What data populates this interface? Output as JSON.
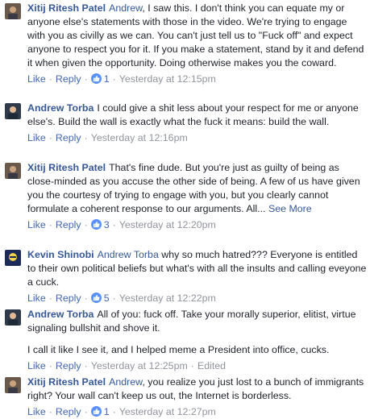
{
  "comments": [
    {
      "author": "Xitij Ritesh Patel",
      "mention": "Andrew",
      "text": ", I saw this. I don't think you can equate my or anyone else's statements with those in the video. We're trying to engage with you as civilly as we can. You can't just tell us to \"Fuck off\" and expect anyone to respect you for it. If you make a statement, stand by it and defend it when given the opportunity. Doing otherwise makes you the coward.",
      "like": "Like",
      "reply": "Reply",
      "likes": "1",
      "time": "Yesterday at 12:15pm"
    },
    {
      "author": "Andrew Torba",
      "text": "I could give a shit less about your respect for me or anyone else's. Build the wall is exactly what the fuck it means: build the wall.",
      "like": "Like",
      "reply": "Reply",
      "time": "Yesterday at 12:16pm"
    },
    {
      "author": "Xitij Ritesh Patel",
      "text": "That's fine dude. But you're just as guilty of being as close-minded as you accuse the other side of being. A few of us have given you the courtesy of trying to engage with you, but you clearly cannot formulate a coherent response to our arguments.",
      "trail": "All...",
      "see_more": "See More",
      "like": "Like",
      "reply": "Reply",
      "likes": "3",
      "time": "Yesterday at 12:20pm"
    },
    {
      "author": "Kevin Shinobi",
      "mention": "Andrew Torba",
      "text": " why so much hatred??? Everyone is entitled to their own political beliefs but what's with all the insults and calling eveyone a cuck.",
      "like": "Like",
      "reply": "Reply",
      "likes": "5",
      "time": "Yesterday at 12:22pm"
    },
    {
      "author": "Andrew Torba",
      "text": "All of you: fuck off. Take your morally superior, elitist, virtue signaling bullshit and shove it.",
      "text2": "I call it like I see it, and I helped meme a President into office, cucks.",
      "like": "Like",
      "reply": "Reply",
      "time": "Yesterday at 12:25pm",
      "edited": "Edited"
    },
    {
      "author": "Xitij Ritesh Patel",
      "mention": "Andrew",
      "text": ", you realize you just lost to a bunch of immigrants right? Your wall can't keep us out, the Internet is borderless.",
      "like": "Like",
      "reply": "Reply",
      "likes": "1",
      "time": "Yesterday at 12:27pm"
    }
  ],
  "colors": {
    "link": "#365899",
    "action": "#4267b2",
    "meta": "#90949c",
    "like_badge": "#5890ff"
  },
  "icons": {
    "like_badge": "thumbs-up-icon"
  }
}
